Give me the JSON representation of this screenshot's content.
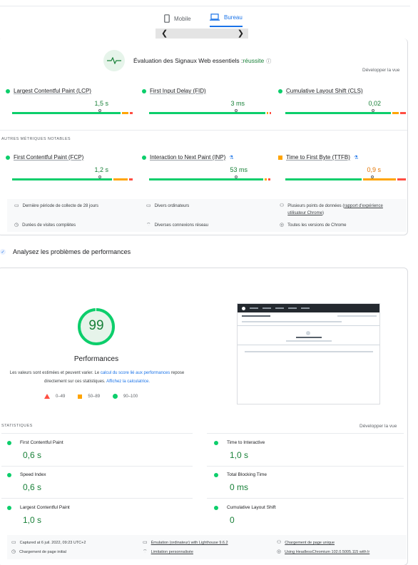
{
  "tabs": {
    "mobile": "Mobile",
    "desktop": "Bureau"
  },
  "cwv": {
    "assessment_prefix": "Évaluation des Signaux Web essentiels :",
    "assessment_result": "réussite",
    "expand": "Développer la vue",
    "metrics_core": [
      {
        "name": "Largest Contentful Paint (LCP)",
        "value": "1,5 s"
      },
      {
        "name": "First Input Delay (FID)",
        "value": "3 ms"
      },
      {
        "name": "Cumulative Layout Shift (CLS)",
        "value": "0,02"
      }
    ],
    "other_label": "AUTRES MÉTRIQUES NOTABLES",
    "metrics_other": [
      {
        "name": "First Contentful Paint (FCP)",
        "value": "1,2 s"
      },
      {
        "name": "Interaction to Next Paint (INP)",
        "value": "53 ms"
      },
      {
        "name": "Time to First Byte (TTFB)",
        "value": "0,9 s"
      }
    ],
    "info": {
      "period": "Dernière période de collecte de 28 jours",
      "devices": "Divers ordinateurs",
      "datapoints_prefix": "Plusieurs points de données (",
      "datapoints_link": "rapport d'expérience utilisateur Chrome",
      "datapoints_suffix": ")",
      "visits": "Durées de visites complètes",
      "network": "Diverses connexions réseau",
      "chrome": "Toutes les versions de Chrome"
    }
  },
  "analyze_title": "Analysez les problèmes de performances",
  "perf": {
    "score": "99",
    "score_fraction": 0.99,
    "title": "Performances",
    "note_prefix": "Les valeurs sont estimées et peuvent varier. Le ",
    "note_link1": "calcul du score lié aux performances",
    "note_mid": " repose directement sur ces statistiques. ",
    "note_link2": "Affichez la calculatrice.",
    "legend": [
      {
        "range": "0–49"
      },
      {
        "range": "50–89"
      },
      {
        "range": "90–100"
      }
    ]
  },
  "stats": {
    "label": "STATISTIQUES",
    "expand": "Développer la vue",
    "items": [
      {
        "name": "First Contentful Paint",
        "value": "0,6 s"
      },
      {
        "name": "Time to Interactive",
        "value": "1,0 s"
      },
      {
        "name": "Speed Index",
        "value": "0,6 s"
      },
      {
        "name": "Total Blocking Time",
        "value": "0 ms"
      },
      {
        "name": "Largest Contentful Paint",
        "value": "1,0 s"
      },
      {
        "name": "Cumulative Layout Shift",
        "value": "0"
      }
    ]
  },
  "footer": {
    "captured": "Captured at 6 juil. 2022, 09:23 UTC+2",
    "emulation": "Émulation (ordinateur) with Lighthouse 9.6.2",
    "single_load": "Chargement de page unique",
    "initial_load": "Chargement de page initial",
    "throttling": "Limitation personnalisée",
    "browser": "Using HeadlessChromium 102.0.5005.115 with lr"
  },
  "colors": {
    "good": "#0cce6b",
    "average": "#ffa400",
    "poor": "#ff4e42",
    "accent": "#1a73e8"
  }
}
